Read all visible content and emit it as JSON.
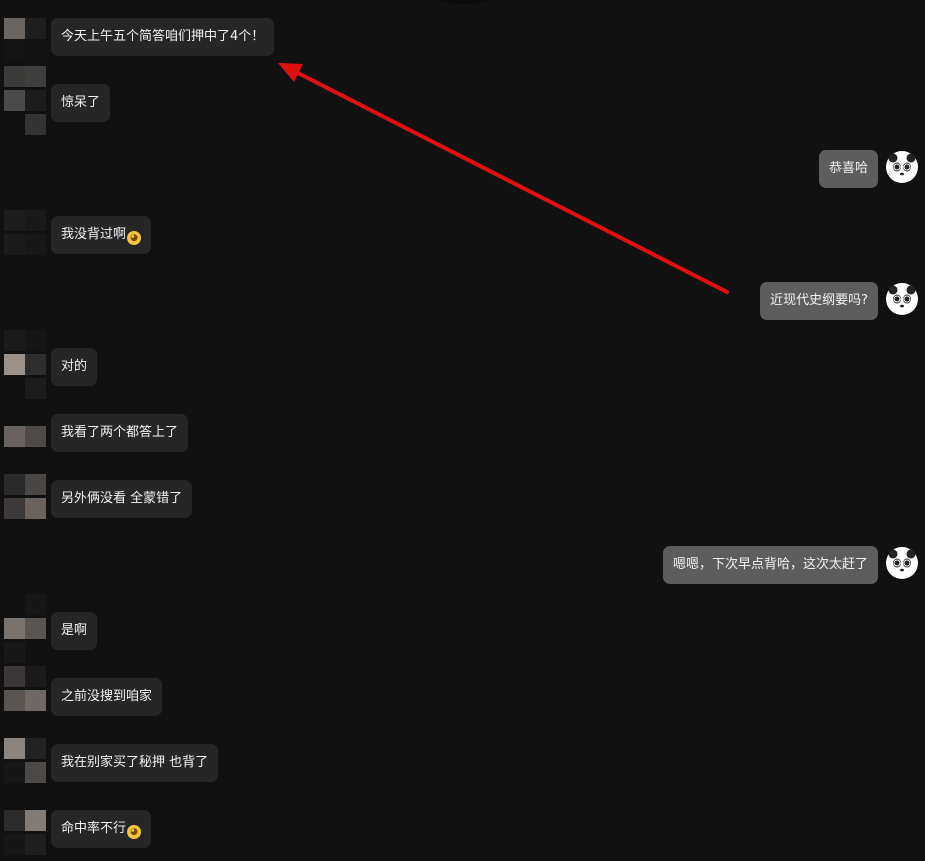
{
  "colors": {
    "background": "#111111",
    "left_bubble": "#262626",
    "right_bubble": "#5d5d5d",
    "text": "#f2f2f2",
    "annotation_arrow": "#e01010"
  },
  "messages": [
    {
      "side": "left",
      "text": "今天上午五个简答咱们押中了4个！",
      "emoji": null
    },
    {
      "side": "left",
      "text": "惊呆了",
      "emoji": null
    },
    {
      "side": "right",
      "text": "恭喜哈",
      "emoji": null
    },
    {
      "side": "left",
      "text": "我没背过啊",
      "emoji": "crying-face-emoji"
    },
    {
      "side": "right",
      "text": "近现代史纲要吗?",
      "emoji": null
    },
    {
      "side": "left",
      "text": "对的",
      "emoji": null
    },
    {
      "side": "left",
      "text": "我看了两个都答上了",
      "emoji": null
    },
    {
      "side": "left",
      "text": "另外俩没看 全蒙错了",
      "emoji": null
    },
    {
      "side": "right",
      "text": "嗯嗯，下次早点背哈，这次太赶了",
      "emoji": null
    },
    {
      "side": "left",
      "text": "是啊",
      "emoji": null
    },
    {
      "side": "left",
      "text": "之前没搜到咱家",
      "emoji": null
    },
    {
      "side": "left",
      "text": "我在别家买了秘押 也背了",
      "emoji": null
    },
    {
      "side": "left",
      "text": "命中率不行",
      "emoji": "crying-face-emoji"
    }
  ],
  "icons": {
    "self_avatar": "panda-avatar-icon",
    "peer_avatar": "pixelated-avatar-icon",
    "annotation": "red-arrow-icon"
  }
}
